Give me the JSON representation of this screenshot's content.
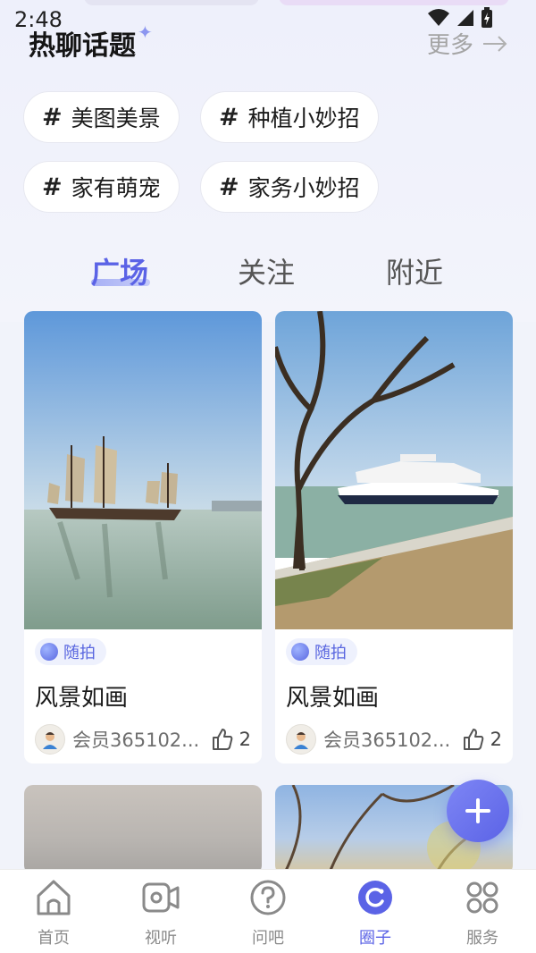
{
  "status_bar": {
    "time": "2:48"
  },
  "hot_topics": {
    "title": "热聊话题",
    "more_label": "更多",
    "chips": [
      {
        "hash": "#",
        "label": "美图美景"
      },
      {
        "hash": "#",
        "label": "种植小妙招"
      },
      {
        "hash": "#",
        "label": "家有萌宠"
      },
      {
        "hash": "#",
        "label": "家务小妙招"
      }
    ]
  },
  "tabs": [
    {
      "label": "广场",
      "active": true
    },
    {
      "label": "关注",
      "active": false
    },
    {
      "label": "附近",
      "active": false
    }
  ],
  "posts": [
    {
      "tag": "随拍",
      "title": "风景如画",
      "user": "会员365102...",
      "likes": "2"
    },
    {
      "tag": "随拍",
      "title": "风景如画",
      "user": "会员365102...",
      "likes": "2"
    }
  ],
  "fab": {
    "icon": "plus-icon"
  },
  "bottom_nav": [
    {
      "label": "首页",
      "icon": "home-icon"
    },
    {
      "label": "视听",
      "icon": "video-icon"
    },
    {
      "label": "问吧",
      "icon": "question-icon"
    },
    {
      "label": "圈子",
      "icon": "circle-icon",
      "active": true
    },
    {
      "label": "服务",
      "icon": "services-icon"
    }
  ],
  "colors": {
    "accent": "#5b63e6",
    "background": "#f1f3fa",
    "chip_bg": "#ffffff"
  }
}
